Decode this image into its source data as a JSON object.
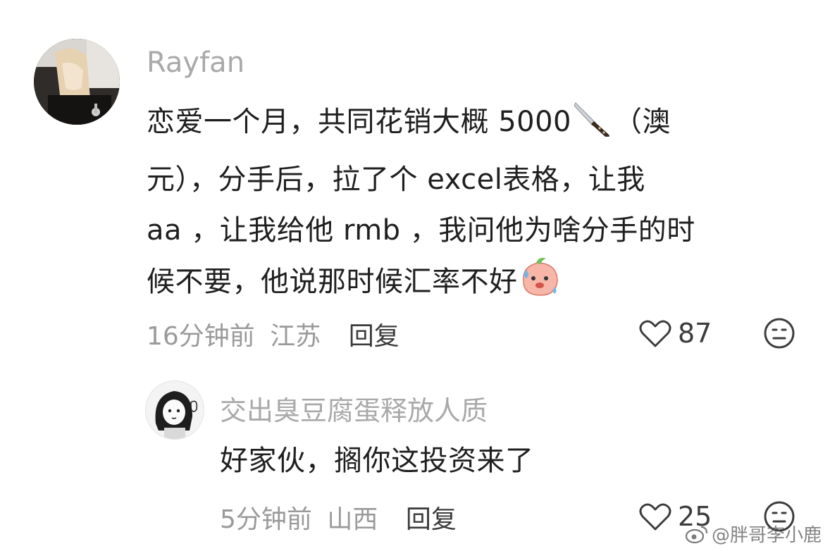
{
  "comments": [
    {
      "username": "Rayfan",
      "text_lines": [
        "恋爱一个月，共同花销大概 5000",
        "（澳",
        "元），分手后，拉了个 excel表格，让我",
        " aa ，让我给他 rmb ，我问他为啥分手的时",
        "候不要，他说那时候汇率不好"
      ],
      "time": "16分钟前",
      "location": "江苏",
      "reply_label": "回复",
      "likes": "87",
      "avatar_icon": "avatar-photo-woman",
      "emojis": [
        "knife-icon",
        "sweating-peach-emoji"
      ]
    },
    {
      "username": "交出臭豆腐蛋释放人质",
      "text": "好家伙，搁你这投资来了",
      "time": "5分钟前",
      "location": "山西",
      "reply_label": "回复",
      "likes": "25",
      "avatar_icon": "avatar-cartoon-girl"
    }
  ],
  "watermark": {
    "text": "@胖哥李小鹿",
    "icon": "weibo-logo-icon"
  },
  "colors": {
    "username": "#a9a9a9",
    "body": "#1f1f1f",
    "meta": "#9a9a9a",
    "action": "#3c3c3c"
  }
}
